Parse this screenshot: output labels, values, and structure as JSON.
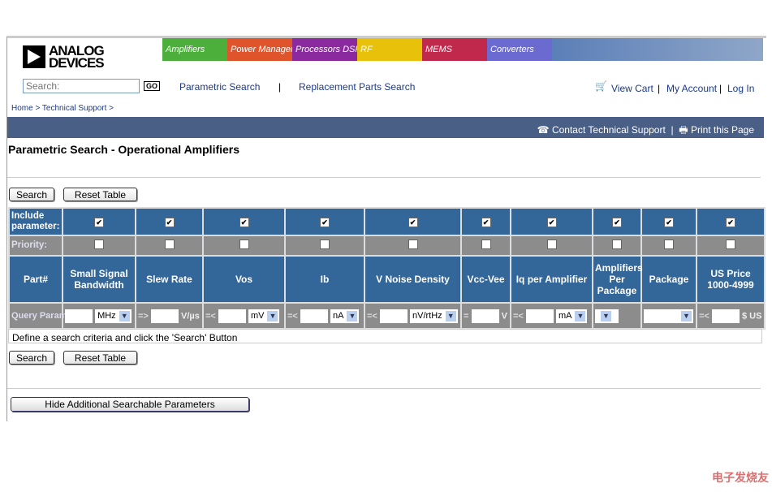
{
  "brand": {
    "line1": "ANALOG",
    "line2": "DEVICES"
  },
  "banner": [
    {
      "label": "Amplifiers",
      "color": "#4caf3c"
    },
    {
      "label": "Power Management",
      "color": "#e0542c"
    },
    {
      "label": "Processors DSP",
      "color": "#8a2a9e"
    },
    {
      "label": "RF",
      "color": "#e8c20a"
    },
    {
      "label": "MEMS",
      "color": "#c0284c"
    },
    {
      "label": "Converters",
      "color": "#6a6ad0"
    }
  ],
  "nav": {
    "search_placeholder": "Search:",
    "go": "GO",
    "parametric": "Parametric Search",
    "sep": "|",
    "replacement": "Replacement Parts Search",
    "view_cart": "View Cart",
    "my_account": "My Account",
    "log_in": "Log In"
  },
  "breadcrumb": [
    "Home >",
    "Technical Support >"
  ],
  "bar": {
    "contact": "Contact Technical Support",
    "print": "Print this Page"
  },
  "page_title": "Parametric Search - Operational Amplifiers",
  "buttons": {
    "search": "Search",
    "reset": "Reset Table",
    "hide": "Hide Additional Searchable Parameters"
  },
  "table": {
    "include_label": "Include parameter:",
    "priority_label": "Priority:",
    "query_label": "Query Parameter:",
    "columns": [
      {
        "name": "Part#"
      },
      {
        "name": "Small Signal Bandwidth",
        "op": "",
        "unit": "MHz",
        "unit_select": true,
        "include": true,
        "priority": false
      },
      {
        "name": "Slew Rate",
        "op": "=>",
        "unit": "V/µs",
        "unit_select": false,
        "include": true,
        "priority": false
      },
      {
        "name": "Vos",
        "op": "=<",
        "unit": "mV",
        "unit_select": true,
        "include": true,
        "priority": false
      },
      {
        "name": "Ib",
        "op": "=<",
        "unit": "nA",
        "unit_select": true,
        "include": true,
        "priority": false
      },
      {
        "name": "V Noise Density",
        "op": "=<",
        "unit": "nV/rtHz",
        "unit_select": true,
        "include": true,
        "priority": false
      },
      {
        "name": "Vcc-Vee",
        "op": "=",
        "unit": "V",
        "unit_select": false,
        "include": true,
        "priority": false
      },
      {
        "name": "Iq per Amplifier",
        "op": "=<",
        "unit": "mA",
        "unit_select": true,
        "include": true,
        "priority": false
      },
      {
        "name": "Amplifiers Per Package",
        "op": "",
        "unit": "",
        "unit_select": "only",
        "include": true,
        "priority": false
      },
      {
        "name": "Package",
        "op": "",
        "unit": "",
        "unit_select": "wide",
        "include": true,
        "priority": false
      },
      {
        "name": "US Price 1000-4999",
        "op": "=<",
        "unit": "$ US",
        "unit_select": false,
        "include": true,
        "priority": false
      }
    ]
  },
  "message": "Define a search criteria and click the 'Search' Button",
  "watermark": "电子发烧友",
  "colors": {
    "header_blue": "#336699",
    "row_gray": "#8c8c8c",
    "bar": "#4a5f86"
  }
}
